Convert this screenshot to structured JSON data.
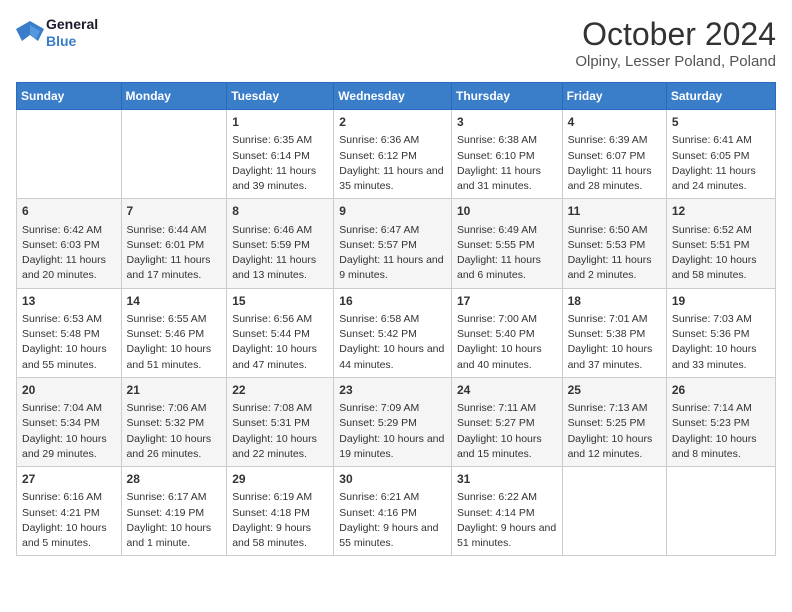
{
  "header": {
    "logo_line1": "General",
    "logo_line2": "Blue",
    "month": "October 2024",
    "location": "Olpiny, Lesser Poland, Poland"
  },
  "weekdays": [
    "Sunday",
    "Monday",
    "Tuesday",
    "Wednesday",
    "Thursday",
    "Friday",
    "Saturday"
  ],
  "weeks": [
    [
      {
        "day": "",
        "content": ""
      },
      {
        "day": "",
        "content": ""
      },
      {
        "day": "1",
        "content": "Sunrise: 6:35 AM\nSunset: 6:14 PM\nDaylight: 11 hours and 39 minutes."
      },
      {
        "day": "2",
        "content": "Sunrise: 6:36 AM\nSunset: 6:12 PM\nDaylight: 11 hours and 35 minutes."
      },
      {
        "day": "3",
        "content": "Sunrise: 6:38 AM\nSunset: 6:10 PM\nDaylight: 11 hours and 31 minutes."
      },
      {
        "day": "4",
        "content": "Sunrise: 6:39 AM\nSunset: 6:07 PM\nDaylight: 11 hours and 28 minutes."
      },
      {
        "day": "5",
        "content": "Sunrise: 6:41 AM\nSunset: 6:05 PM\nDaylight: 11 hours and 24 minutes."
      }
    ],
    [
      {
        "day": "6",
        "content": "Sunrise: 6:42 AM\nSunset: 6:03 PM\nDaylight: 11 hours and 20 minutes."
      },
      {
        "day": "7",
        "content": "Sunrise: 6:44 AM\nSunset: 6:01 PM\nDaylight: 11 hours and 17 minutes."
      },
      {
        "day": "8",
        "content": "Sunrise: 6:46 AM\nSunset: 5:59 PM\nDaylight: 11 hours and 13 minutes."
      },
      {
        "day": "9",
        "content": "Sunrise: 6:47 AM\nSunset: 5:57 PM\nDaylight: 11 hours and 9 minutes."
      },
      {
        "day": "10",
        "content": "Sunrise: 6:49 AM\nSunset: 5:55 PM\nDaylight: 11 hours and 6 minutes."
      },
      {
        "day": "11",
        "content": "Sunrise: 6:50 AM\nSunset: 5:53 PM\nDaylight: 11 hours and 2 minutes."
      },
      {
        "day": "12",
        "content": "Sunrise: 6:52 AM\nSunset: 5:51 PM\nDaylight: 10 hours and 58 minutes."
      }
    ],
    [
      {
        "day": "13",
        "content": "Sunrise: 6:53 AM\nSunset: 5:48 PM\nDaylight: 10 hours and 55 minutes."
      },
      {
        "day": "14",
        "content": "Sunrise: 6:55 AM\nSunset: 5:46 PM\nDaylight: 10 hours and 51 minutes."
      },
      {
        "day": "15",
        "content": "Sunrise: 6:56 AM\nSunset: 5:44 PM\nDaylight: 10 hours and 47 minutes."
      },
      {
        "day": "16",
        "content": "Sunrise: 6:58 AM\nSunset: 5:42 PM\nDaylight: 10 hours and 44 minutes."
      },
      {
        "day": "17",
        "content": "Sunrise: 7:00 AM\nSunset: 5:40 PM\nDaylight: 10 hours and 40 minutes."
      },
      {
        "day": "18",
        "content": "Sunrise: 7:01 AM\nSunset: 5:38 PM\nDaylight: 10 hours and 37 minutes."
      },
      {
        "day": "19",
        "content": "Sunrise: 7:03 AM\nSunset: 5:36 PM\nDaylight: 10 hours and 33 minutes."
      }
    ],
    [
      {
        "day": "20",
        "content": "Sunrise: 7:04 AM\nSunset: 5:34 PM\nDaylight: 10 hours and 29 minutes."
      },
      {
        "day": "21",
        "content": "Sunrise: 7:06 AM\nSunset: 5:32 PM\nDaylight: 10 hours and 26 minutes."
      },
      {
        "day": "22",
        "content": "Sunrise: 7:08 AM\nSunset: 5:31 PM\nDaylight: 10 hours and 22 minutes."
      },
      {
        "day": "23",
        "content": "Sunrise: 7:09 AM\nSunset: 5:29 PM\nDaylight: 10 hours and 19 minutes."
      },
      {
        "day": "24",
        "content": "Sunrise: 7:11 AM\nSunset: 5:27 PM\nDaylight: 10 hours and 15 minutes."
      },
      {
        "day": "25",
        "content": "Sunrise: 7:13 AM\nSunset: 5:25 PM\nDaylight: 10 hours and 12 minutes."
      },
      {
        "day": "26",
        "content": "Sunrise: 7:14 AM\nSunset: 5:23 PM\nDaylight: 10 hours and 8 minutes."
      }
    ],
    [
      {
        "day": "27",
        "content": "Sunrise: 6:16 AM\nSunset: 4:21 PM\nDaylight: 10 hours and 5 minutes."
      },
      {
        "day": "28",
        "content": "Sunrise: 6:17 AM\nSunset: 4:19 PM\nDaylight: 10 hours and 1 minute."
      },
      {
        "day": "29",
        "content": "Sunrise: 6:19 AM\nSunset: 4:18 PM\nDaylight: 9 hours and 58 minutes."
      },
      {
        "day": "30",
        "content": "Sunrise: 6:21 AM\nSunset: 4:16 PM\nDaylight: 9 hours and 55 minutes."
      },
      {
        "day": "31",
        "content": "Sunrise: 6:22 AM\nSunset: 4:14 PM\nDaylight: 9 hours and 51 minutes."
      },
      {
        "day": "",
        "content": ""
      },
      {
        "day": "",
        "content": ""
      }
    ]
  ]
}
